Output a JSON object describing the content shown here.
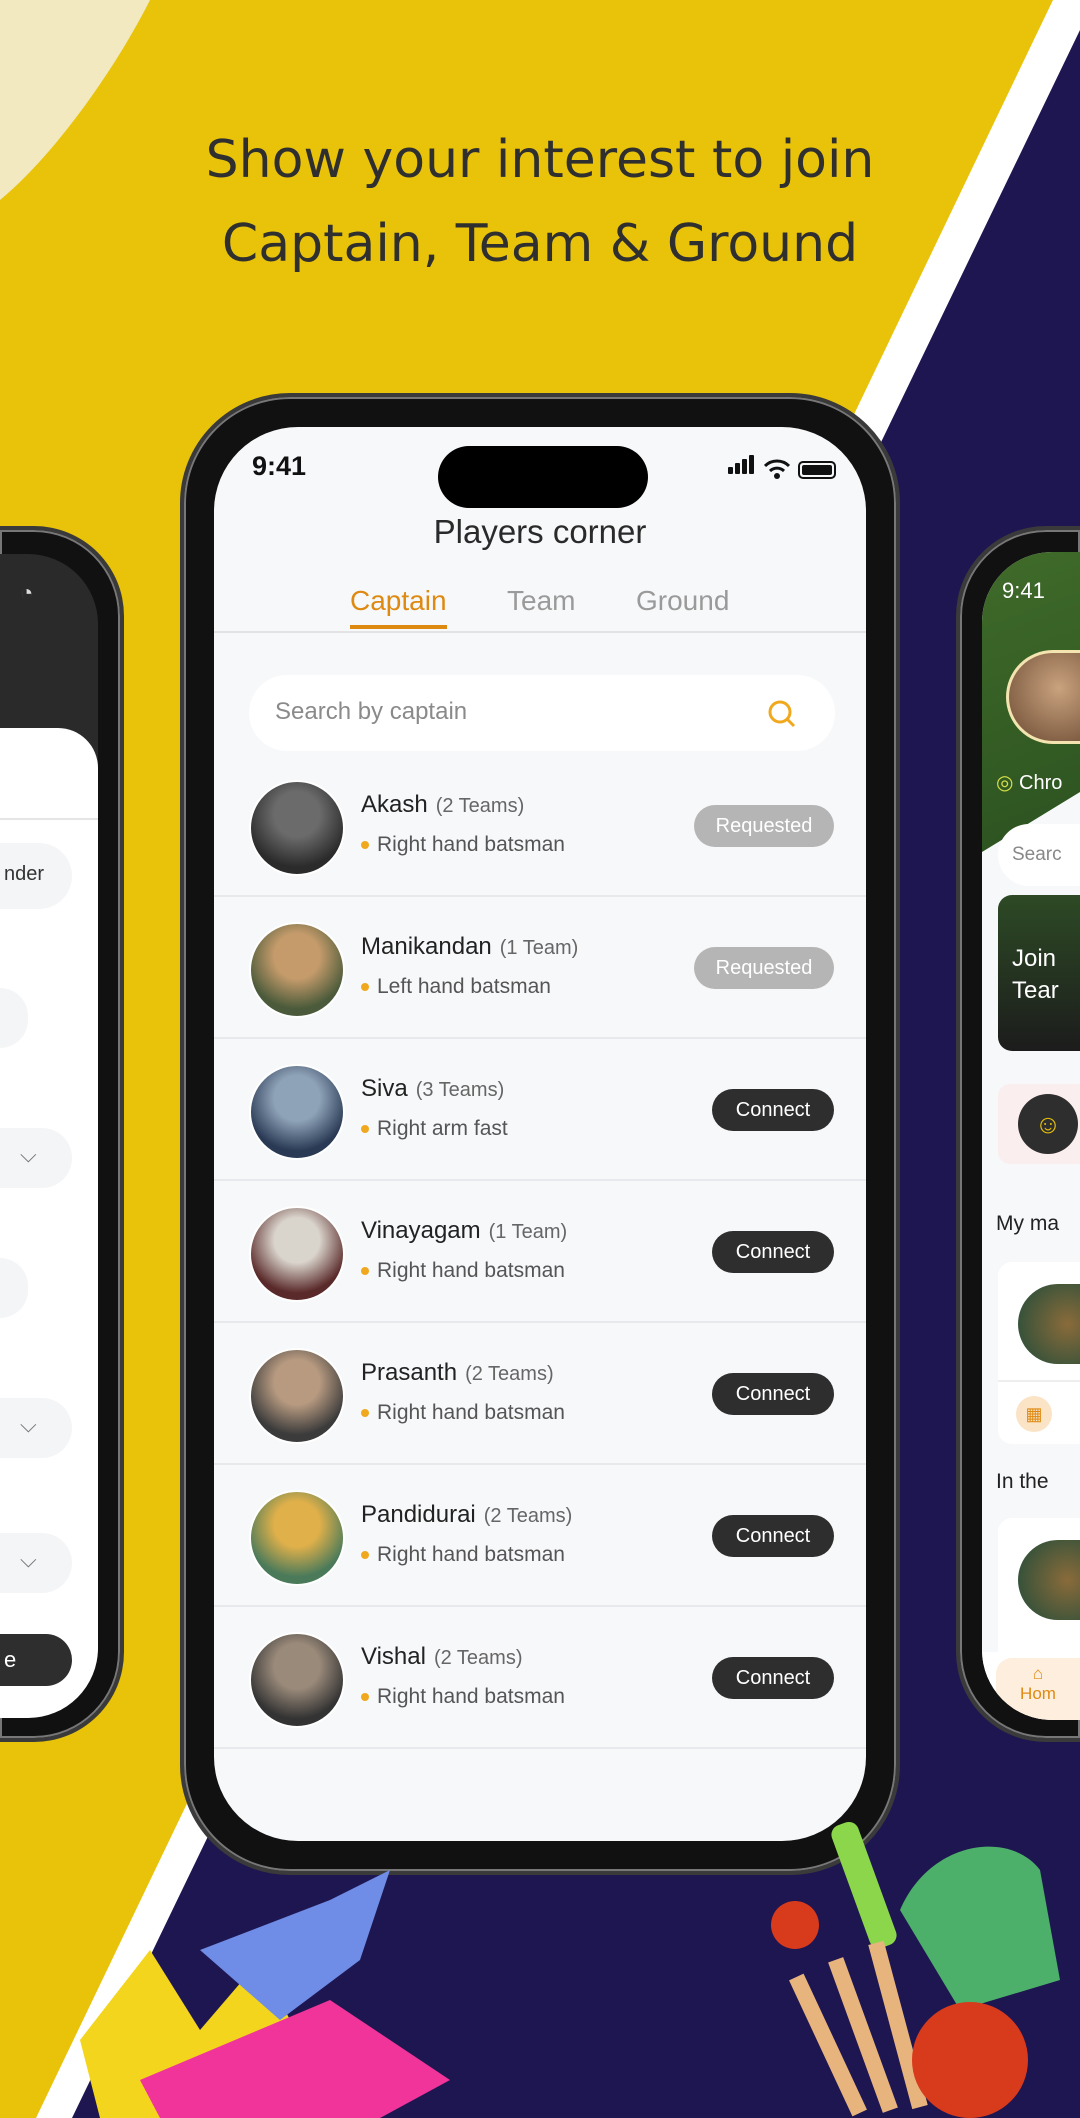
{
  "headline": {
    "line1": "Show your interest to join",
    "line2": "Captain, Team & Ground"
  },
  "colors": {
    "yellow": "#E9C309",
    "navy": "#1E1650",
    "accent": "#DE8A12",
    "requested": "#B5B5B5",
    "connect": "#2E2E2E"
  },
  "main_phone": {
    "status": {
      "time": "9:41"
    },
    "title": "Players corner",
    "tabs": [
      {
        "label": "Captain",
        "active": true
      },
      {
        "label": "Team",
        "active": false
      },
      {
        "label": "Ground",
        "active": false
      }
    ],
    "search": {
      "placeholder": "Search by captain",
      "icon": "search-icon"
    },
    "players": [
      {
        "name": "Akash",
        "teams": "(2 Teams)",
        "role": "Right hand batsman",
        "action": "Requested"
      },
      {
        "name": "Manikandan",
        "teams": "(1 Team)",
        "role": "Left hand batsman",
        "action": "Requested"
      },
      {
        "name": "Siva",
        "teams": "(3 Teams)",
        "role": "Right arm fast",
        "action": "Connect"
      },
      {
        "name": "Vinayagam",
        "teams": "(1 Team)",
        "role": "Right hand batsman",
        "action": "Connect"
      },
      {
        "name": "Prasanth",
        "teams": "(2 Teams)",
        "role": "Right hand batsman",
        "action": "Connect"
      },
      {
        "name": "Pandidurai",
        "teams": "(2 Teams)",
        "role": "Right hand batsman",
        "action": "Connect"
      },
      {
        "name": "Vishal",
        "teams": "(2 Teams)",
        "role": "Right hand batsman",
        "action": "Connect"
      }
    ]
  },
  "left_phone": {
    "partial_field": "nder",
    "partial_button": "e"
  },
  "right_phone": {
    "time": "9:41",
    "location": "Chro",
    "search": "Searc",
    "banner": [
      "Join",
      "Tear"
    ],
    "section1": "My ma",
    "section2": "In the",
    "nav_home": "Hom"
  }
}
